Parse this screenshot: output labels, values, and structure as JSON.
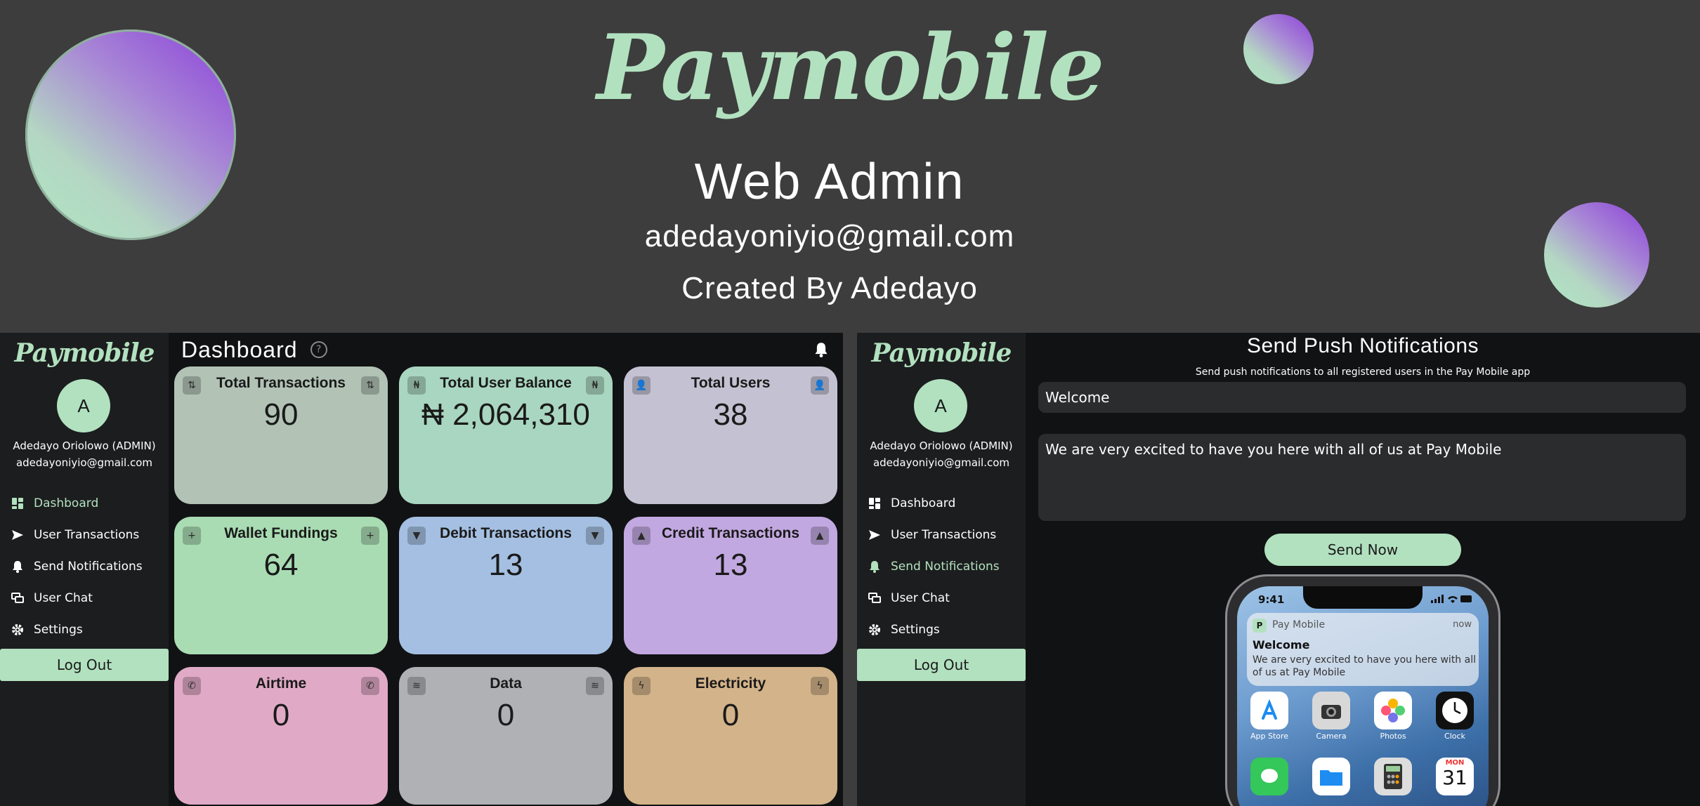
{
  "hero": {
    "logo": "Paymobile",
    "title": "Web Admin",
    "email": "adedayoniyio@gmail.com",
    "credit": "Created By Adedayo"
  },
  "sidebar": {
    "logo": "Paymobile",
    "avatar_letter": "A",
    "user_name": "Adedayo Oriolowo (ADMIN)",
    "user_email": "adedayoniyio@gmail.com",
    "items": [
      {
        "label": "Dashboard",
        "icon": "dashboard-icon"
      },
      {
        "label": "User Transactions",
        "icon": "send-icon"
      },
      {
        "label": "Send Notifications",
        "icon": "bell-icon"
      },
      {
        "label": "User Chat",
        "icon": "chat-icon"
      },
      {
        "label": "Settings",
        "icon": "gear-icon"
      }
    ],
    "logout": "Log Out"
  },
  "dashboard": {
    "title": "Dashboard",
    "help_glyph": "?",
    "cards": [
      {
        "label": "Total Transactions",
        "value": "90",
        "color": "#b2c3b6",
        "icon": "swap-icon"
      },
      {
        "label": "Total User Balance",
        "value": "₦ 2,064,310",
        "color": "#a9d6c0",
        "icon": "naira-icon"
      },
      {
        "label": "Total Users",
        "value": "38",
        "color": "#c4c2d2",
        "icon": "user-icon"
      },
      {
        "label": "Wallet Fundings",
        "value": "64",
        "color": "#a9dcb3",
        "icon": "plus-icon"
      },
      {
        "label": "Debit Transactions",
        "value": "13",
        "color": "#a4bfe1",
        "icon": "down-arrow-icon"
      },
      {
        "label": "Credit Transactions",
        "value": "13",
        "color": "#c2a8e0",
        "icon": "up-arrow-icon"
      },
      {
        "label": "Airtime",
        "value": "0",
        "color": "#e0aac6",
        "icon": "phone-icon"
      },
      {
        "label": "Data",
        "value": "0",
        "color": "#b0b1b5",
        "icon": "wifi-icon"
      },
      {
        "label": "Electricity",
        "value": "0",
        "color": "#d3b389",
        "icon": "bolt-icon"
      }
    ]
  },
  "notifications": {
    "title": "Send Push Notifications",
    "subtitle": "Send push notifications to all registered users in the Pay Mobile app",
    "title_value": "Welcome",
    "body_value": "We are very excited to have you here with all of us at Pay Mobile",
    "send_button": "Send Now"
  },
  "phone": {
    "time": "9:41",
    "notif_app": "Pay Mobile",
    "notif_app_letter": "P",
    "notif_time": "now",
    "notif_title": "Welcome",
    "notif_body": "We are very excited to have you here with all of us at Pay Mobile",
    "apps_row1": [
      {
        "name": "App Store",
        "icon": "app-store-icon"
      },
      {
        "name": "Camera",
        "icon": "camera-icon"
      },
      {
        "name": "Photos",
        "icon": "photos-icon"
      },
      {
        "name": "Clock",
        "icon": "clock-icon"
      }
    ],
    "calendar_day": "MON",
    "calendar_date": "31"
  }
}
